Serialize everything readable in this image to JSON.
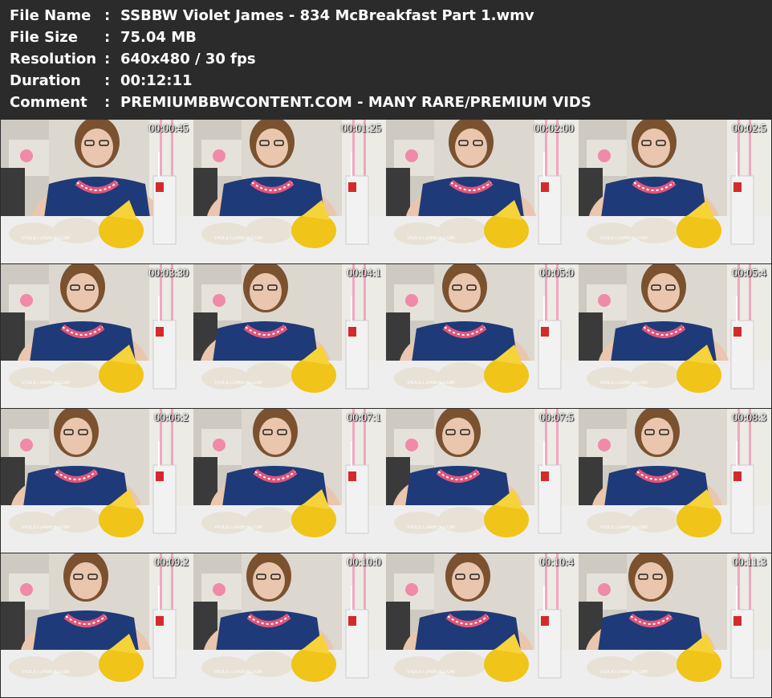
{
  "info": {
    "file_name_label": "File Name",
    "file_name": "SSBBW Violet James - 834 McBreakfast Part 1.wmv",
    "file_size_label": "File Size",
    "file_size": "75.04 MB",
    "resolution_label": "Resolution",
    "resolution": "640x480 / 30 fps",
    "duration_label": "Duration",
    "duration": "00:12:11",
    "comment_label": "Comment",
    "comment": "PREMIUMBBWCONTENT.COM - MANY RARE/PREMIUM VIDS",
    "separator": ":"
  },
  "thumbnails": [
    {
      "timestamp": "00:00:45",
      "watermark": "VIOLETJAMES.COM"
    },
    {
      "timestamp": "00:01:25",
      "watermark": "VIOLETJAMES.COM"
    },
    {
      "timestamp": "00:02:00",
      "watermark": "VIOLETJAMES.COM"
    },
    {
      "timestamp": "00:02:5",
      "watermark": "VIOLETJAMES.COM"
    },
    {
      "timestamp": "00:03:30",
      "watermark": "VIOLETJAMES.COM"
    },
    {
      "timestamp": "00:04:1",
      "watermark": "VIOLETJAMES.COM"
    },
    {
      "timestamp": "00:05:0",
      "watermark": "VIOLETJAMES.COM"
    },
    {
      "timestamp": "00:05:4",
      "watermark": "VIOLETJAMES.COM"
    },
    {
      "timestamp": "00:06:2",
      "watermark": "VIOLETJAMES.COM"
    },
    {
      "timestamp": "00:07:1",
      "watermark": "VIOLETJAMES.COM"
    },
    {
      "timestamp": "00:07:5",
      "watermark": "VIOLETJAMES.COM"
    },
    {
      "timestamp": "00:08:3",
      "watermark": "VIOLETJAMES.COM"
    },
    {
      "timestamp": "00:09:2",
      "watermark": "VIOLETJAMES.COM"
    },
    {
      "timestamp": "00:10:0",
      "watermark": "VIOLETJAMES.COM"
    },
    {
      "timestamp": "00:10:4",
      "watermark": "VIOLETJAMES.COM"
    },
    {
      "timestamp": "00:11:3",
      "watermark": "VIOLETJAMES.COM"
    }
  ],
  "colors": {
    "background": "#2b2b2b",
    "text": "#ffffff",
    "dress": "#1f3a78",
    "wrapper": "#e8e2d6",
    "cup": "#f2f2f2",
    "bag_yellow": "#f0c419",
    "hair": "#7a5230",
    "skin": "#e9c6ad",
    "trim_pink": "#e0557a"
  }
}
